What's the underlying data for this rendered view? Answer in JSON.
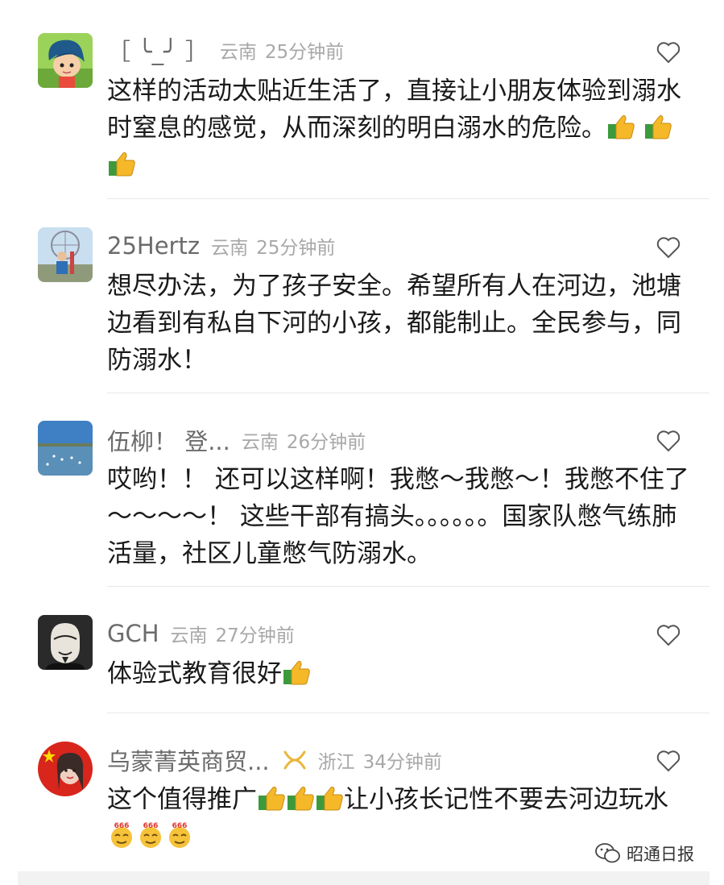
{
  "comments": [
    {
      "name": "［ ╰_╯ ］",
      "location": "云南",
      "time": "25分钟前",
      "text": "这样的活动太贴近生活了，直接让小朋友体验到溺水时窒息的感觉，从而深刻的明白溺水的危险。",
      "emojis": [
        "thumbs-up-icon",
        "thumbs-up-icon",
        "thumbs-up-icon"
      ]
    },
    {
      "name": "25Hertz",
      "location": "云南",
      "time": "25分钟前",
      "text": "想尽办法，为了孩子安全。希望所有人在河边，池塘边看到有私自下河的小孩，都能制止。全民参与，同防溺水！"
    },
    {
      "name": "伍柳！ 登...",
      "location": "云南",
      "time": "26分钟前",
      "text": "哎哟！！ 还可以这样啊！我憋～我憋～！我憋不住了～～～～！ 这些干部有搞头。。。。。。国家队憋气练肺活量，社区儿童憋气防溺水。"
    },
    {
      "name": "GCH",
      "location": "云南",
      "time": "27分钟前",
      "text": "体验式教育很好",
      "emojis": [
        "thumbs-up-icon"
      ]
    },
    {
      "name": "乌蒙菁英商贸...",
      "location": "浙江",
      "time": "34分钟前",
      "text_a": "这个值得推广",
      "text_b": "让小孩长记性不要去河边玩水",
      "emoji_badge": "666"
    }
  ],
  "watermark": "昭通日报",
  "colors": {
    "thumb_yellow": "#f5b829",
    "cuff_green": "#3c9a3c",
    "gold_badge": "#e8b63a"
  }
}
